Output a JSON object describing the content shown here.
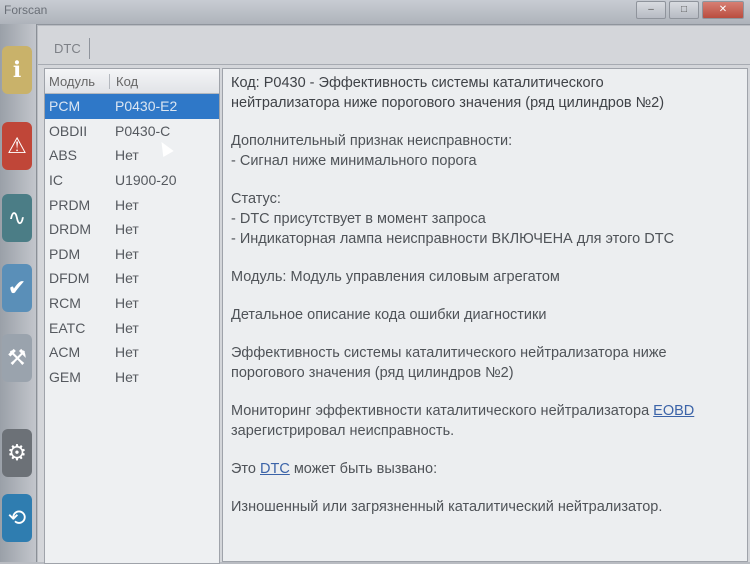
{
  "window": {
    "title": "Forscan",
    "controls": [
      "–",
      "□",
      "✕"
    ]
  },
  "tab": {
    "label": "DTC"
  },
  "list": {
    "headers": [
      "Модуль",
      "Код"
    ],
    "rows": [
      [
        "PCM",
        "P0430-E2"
      ],
      [
        "OBDII",
        "P0430-C"
      ],
      [
        "ABS",
        "Нет"
      ],
      [
        "IC",
        "U1900-20"
      ],
      [
        "PRDM",
        "Нет"
      ],
      [
        "DRDM",
        "Нет"
      ],
      [
        "PDM",
        "Нет"
      ],
      [
        "DFDM",
        "Нет"
      ],
      [
        "RCM",
        "Нет"
      ],
      [
        "EATC",
        "Нет"
      ],
      [
        "ACM",
        "Нет"
      ],
      [
        "GEM",
        "Нет"
      ]
    ],
    "selected_index": 0
  },
  "detail": {
    "code_line1": "Код: P0430 - Эффективность системы каталитического",
    "code_line2": "нейтрализатора ниже порогового значения (ряд цилиндров №2)",
    "extra_title": "Дополнительный признак неисправности:",
    "extra_item": " - Сигнал ниже минимального порога",
    "status_title": "Статус:",
    "status_item1": " - DTC присутствует в момент запроса",
    "status_item2": " - Индикаторная лампа неисправности ВКЛЮЧЕНА для этого DTC",
    "module_line": "Модуль: Модуль управления силовым агрегатом",
    "desc_title": "Детальное описание кода ошибки диагностики",
    "desc_line1": "Эффективность системы каталитического нейтрализатора ниже",
    "desc_line2": "порогового значения (ряд цилиндров №2)",
    "monitor_pre": "Мониторинг эффективности каталитического нейтрализатора ",
    "monitor_link": "EOBD",
    "monitor_post": "зарегистрировал неисправность.",
    "cause_pre": "Это ",
    "cause_link": "DTC",
    "cause_post": " может быть вызвано:",
    "cause_item": "Изношенный или загрязненный каталитический нейтрализатор."
  },
  "icons": [
    "info-icon",
    "warning-icon",
    "oscilloscope-icon",
    "checklist-icon",
    "wrench-icon",
    "gear-icon",
    "connection-icon"
  ]
}
